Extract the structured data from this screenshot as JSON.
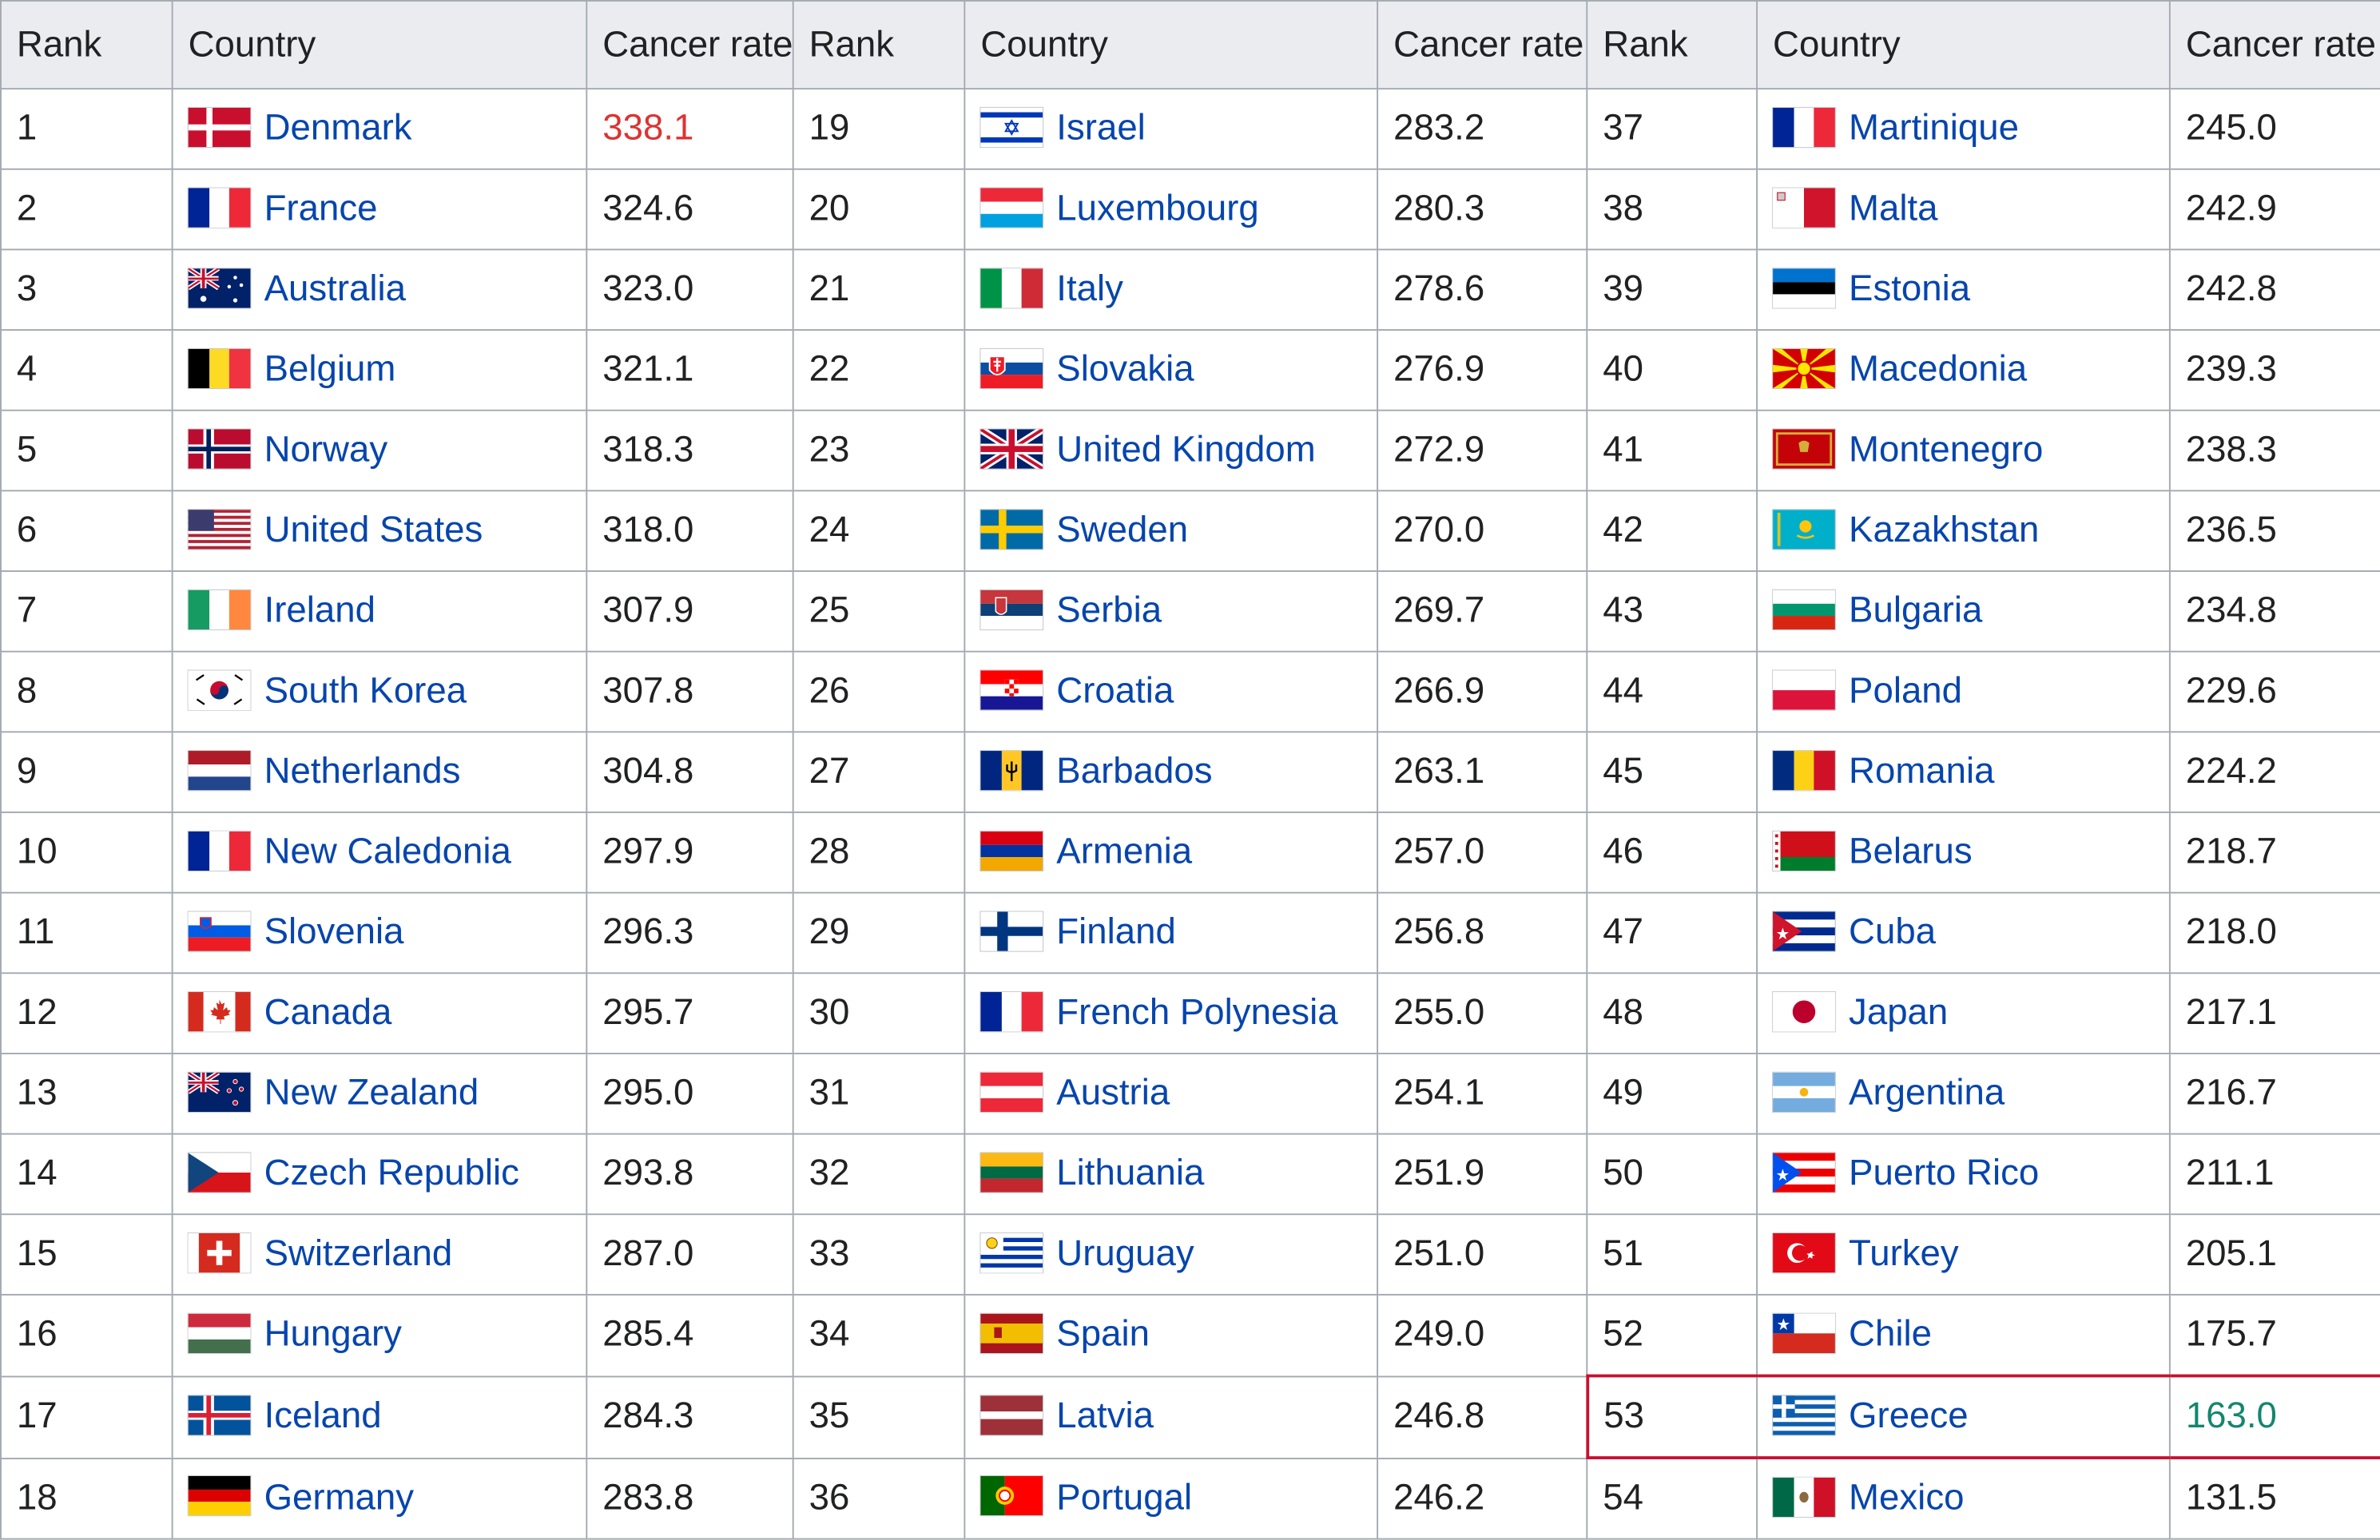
{
  "headers": [
    "Rank",
    "Country",
    "Cancer rate",
    "Rank",
    "Country",
    "Cancer rate",
    "Rank",
    "Country",
    "Cancer rate"
  ],
  "colors": {
    "highest_rate": "#dd3333",
    "lowest_rate": "#14866d",
    "highlight_border": "#c8102e",
    "link": "#0645ad"
  },
  "columns": [
    [
      {
        "rank": "1",
        "country": "Denmark",
        "rate": "338.1",
        "flag": "denmark-flag"
      },
      {
        "rank": "2",
        "country": "France",
        "rate": "324.6",
        "flag": "france-flag"
      },
      {
        "rank": "3",
        "country": "Australia",
        "rate": "323.0",
        "flag": "australia-flag"
      },
      {
        "rank": "4",
        "country": "Belgium",
        "rate": "321.1",
        "flag": "belgium-flag"
      },
      {
        "rank": "5",
        "country": "Norway",
        "rate": "318.3",
        "flag": "norway-flag"
      },
      {
        "rank": "6",
        "country": "United States",
        "rate": "318.0",
        "flag": "united-states-flag"
      },
      {
        "rank": "7",
        "country": "Ireland",
        "rate": "307.9",
        "flag": "ireland-flag"
      },
      {
        "rank": "8",
        "country": "South Korea",
        "rate": "307.8",
        "flag": "south-korea-flag"
      },
      {
        "rank": "9",
        "country": "Netherlands",
        "rate": "304.8",
        "flag": "netherlands-flag"
      },
      {
        "rank": "10",
        "country": "New Caledonia",
        "rate": "297.9",
        "flag": "new-caledonia-flag"
      },
      {
        "rank": "11",
        "country": "Slovenia",
        "rate": "296.3",
        "flag": "slovenia-flag"
      },
      {
        "rank": "12",
        "country": "Canada",
        "rate": "295.7",
        "flag": "canada-flag"
      },
      {
        "rank": "13",
        "country": "New Zealand",
        "rate": "295.0",
        "flag": "new-zealand-flag"
      },
      {
        "rank": "14",
        "country": "Czech Republic",
        "rate": "293.8",
        "flag": "czech-republic-flag"
      },
      {
        "rank": "15",
        "country": "Switzerland",
        "rate": "287.0",
        "flag": "switzerland-flag"
      },
      {
        "rank": "16",
        "country": "Hungary",
        "rate": "285.4",
        "flag": "hungary-flag"
      },
      {
        "rank": "17",
        "country": "Iceland",
        "rate": "284.3",
        "flag": "iceland-flag"
      },
      {
        "rank": "18",
        "country": "Germany",
        "rate": "283.8",
        "flag": "germany-flag"
      }
    ],
    [
      {
        "rank": "19",
        "country": "Israel",
        "rate": "283.2",
        "flag": "israel-flag"
      },
      {
        "rank": "20",
        "country": "Luxembourg",
        "rate": "280.3",
        "flag": "luxembourg-flag"
      },
      {
        "rank": "21",
        "country": "Italy",
        "rate": "278.6",
        "flag": "italy-flag"
      },
      {
        "rank": "22",
        "country": "Slovakia",
        "rate": "276.9",
        "flag": "slovakia-flag"
      },
      {
        "rank": "23",
        "country": "United Kingdom",
        "rate": "272.9",
        "flag": "united-kingdom-flag"
      },
      {
        "rank": "24",
        "country": "Sweden",
        "rate": "270.0",
        "flag": "sweden-flag"
      },
      {
        "rank": "25",
        "country": "Serbia",
        "rate": "269.7",
        "flag": "serbia-flag"
      },
      {
        "rank": "26",
        "country": "Croatia",
        "rate": "266.9",
        "flag": "croatia-flag"
      },
      {
        "rank": "27",
        "country": "Barbados",
        "rate": "263.1",
        "flag": "barbados-flag"
      },
      {
        "rank": "28",
        "country": "Armenia",
        "rate": "257.0",
        "flag": "armenia-flag"
      },
      {
        "rank": "29",
        "country": "Finland",
        "rate": "256.8",
        "flag": "finland-flag"
      },
      {
        "rank": "30",
        "country": "French Polynesia",
        "rate": "255.0",
        "flag": "french-polynesia-flag"
      },
      {
        "rank": "31",
        "country": "Austria",
        "rate": "254.1",
        "flag": "austria-flag"
      },
      {
        "rank": "32",
        "country": "Lithuania",
        "rate": "251.9",
        "flag": "lithuania-flag"
      },
      {
        "rank": "33",
        "country": "Uruguay",
        "rate": "251.0",
        "flag": "uruguay-flag"
      },
      {
        "rank": "34",
        "country": "Spain",
        "rate": "249.0",
        "flag": "spain-flag"
      },
      {
        "rank": "35",
        "country": "Latvia",
        "rate": "246.8",
        "flag": "latvia-flag"
      },
      {
        "rank": "36",
        "country": "Portugal",
        "rate": "246.2",
        "flag": "portugal-flag"
      }
    ],
    [
      {
        "rank": "37",
        "country": "Martinique",
        "rate": "245.0",
        "flag": "martinique-flag"
      },
      {
        "rank": "38",
        "country": "Malta",
        "rate": "242.9",
        "flag": "malta-flag"
      },
      {
        "rank": "39",
        "country": "Estonia",
        "rate": "242.8",
        "flag": "estonia-flag"
      },
      {
        "rank": "40",
        "country": "Macedonia",
        "rate": "239.3",
        "flag": "macedonia-flag"
      },
      {
        "rank": "41",
        "country": "Montenegro",
        "rate": "238.3",
        "flag": "montenegro-flag"
      },
      {
        "rank": "42",
        "country": "Kazakhstan",
        "rate": "236.5",
        "flag": "kazakhstan-flag"
      },
      {
        "rank": "43",
        "country": "Bulgaria",
        "rate": "234.8",
        "flag": "bulgaria-flag"
      },
      {
        "rank": "44",
        "country": "Poland",
        "rate": "229.6",
        "flag": "poland-flag"
      },
      {
        "rank": "45",
        "country": "Romania",
        "rate": "224.2",
        "flag": "romania-flag"
      },
      {
        "rank": "46",
        "country": "Belarus",
        "rate": "218.7",
        "flag": "belarus-flag"
      },
      {
        "rank": "47",
        "country": "Cuba",
        "rate": "218.0",
        "flag": "cuba-flag"
      },
      {
        "rank": "48",
        "country": "Japan",
        "rate": "217.1",
        "flag": "japan-flag"
      },
      {
        "rank": "49",
        "country": "Argentina",
        "rate": "216.7",
        "flag": "argentina-flag"
      },
      {
        "rank": "50",
        "country": "Puerto Rico",
        "rate": "211.1",
        "flag": "puerto-rico-flag"
      },
      {
        "rank": "51",
        "country": "Turkey",
        "rate": "205.1",
        "flag": "turkey-flag"
      },
      {
        "rank": "52",
        "country": "Chile",
        "rate": "175.7",
        "flag": "chile-flag"
      },
      {
        "rank": "53",
        "country": "Greece",
        "rate": "163.0",
        "flag": "greece-flag"
      },
      {
        "rank": "54",
        "country": "Mexico",
        "rate": "131.5",
        "flag": "mexico-flag"
      }
    ]
  ]
}
